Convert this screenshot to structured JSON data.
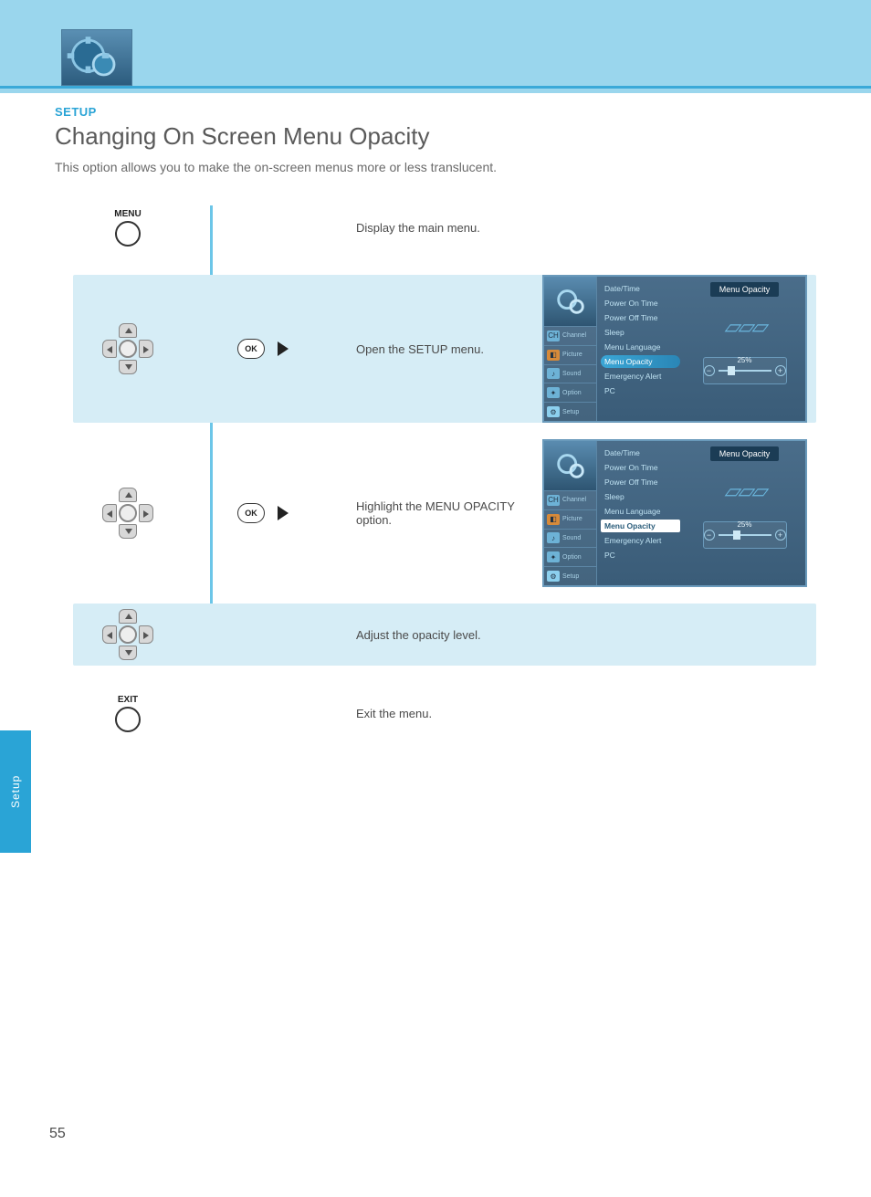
{
  "header": {
    "section_label": "SETUP",
    "page_title": "Changing On Screen Menu Opacity",
    "intro": "This option allows you to make the on-screen menus more or less translucent."
  },
  "remote": {
    "menu_label": "MENU",
    "exit_label": "EXIT",
    "ok_label": "OK"
  },
  "steps": {
    "s1": "Display the main menu.",
    "s2": "Open the SETUP menu.",
    "s3": "Highlight the MENU OPACITY option.",
    "s4": "Adjust the opacity level.",
    "s5": "Exit the menu."
  },
  "tv": {
    "tabs": {
      "channel": "Channel",
      "picture": "Picture",
      "sound": "Sound",
      "option": "Option",
      "setup": "Setup"
    },
    "menu": {
      "date_time": "Date/Time",
      "power_on": "Power On Time",
      "power_off": "Power Off Time",
      "sleep": "Sleep",
      "menu_lang": "Menu Language",
      "menu_opac": "Menu Opacity",
      "emerg": "Emergency Alert",
      "pc": "PC"
    },
    "right_title": "Menu Opacity",
    "slider_value": "25%"
  },
  "side_tab": "Setup",
  "page_number": "55"
}
